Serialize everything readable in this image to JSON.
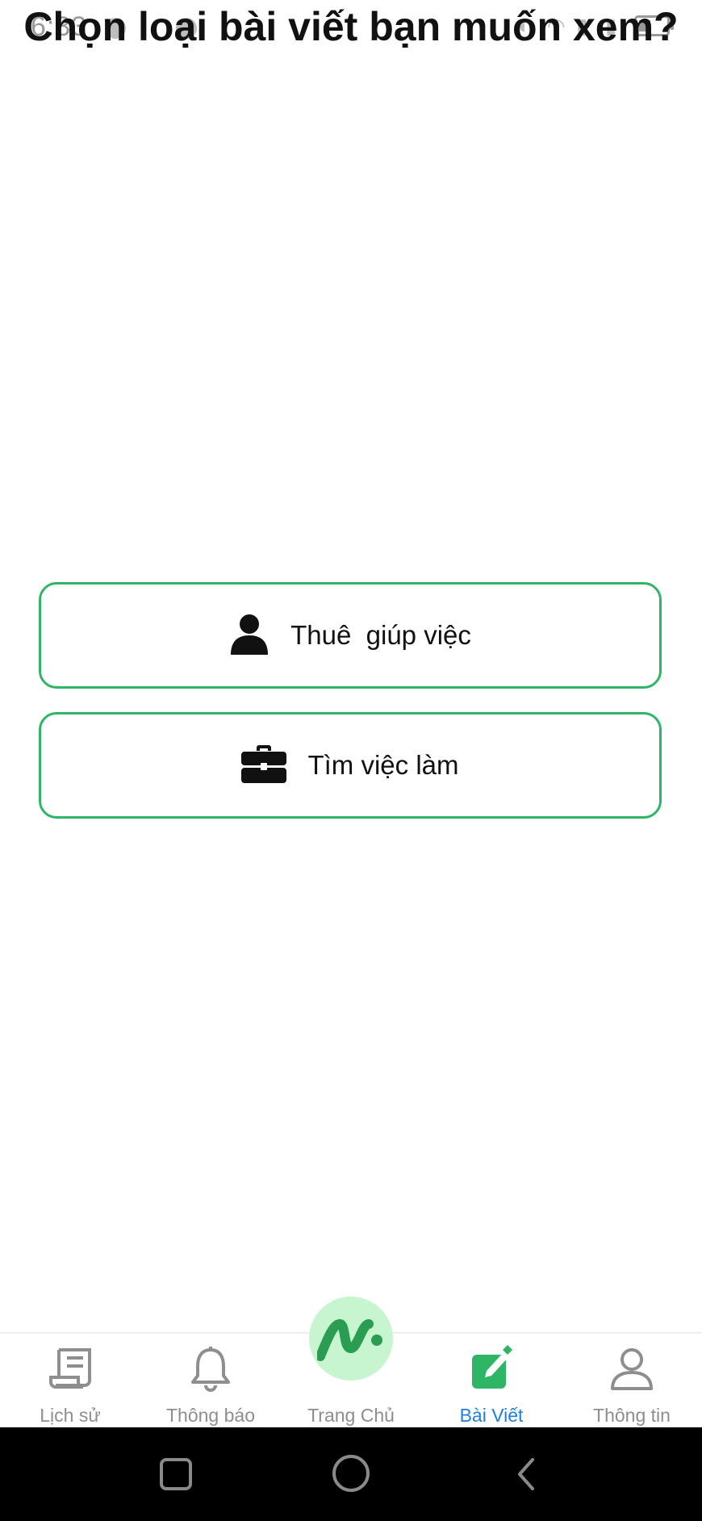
{
  "status_bar": {
    "time": "6:33"
  },
  "header": {
    "title": "Chọn loại bài viết bạn muốn xem?"
  },
  "options": [
    {
      "label": "Thuê  giúp việc",
      "icon": "person-icon"
    },
    {
      "label": "Tìm việc làm",
      "icon": "briefcase-icon"
    }
  ],
  "bottom_nav": {
    "active": "Bài Viết",
    "items": [
      {
        "label": "Lịch sử",
        "icon": "receipt-icon"
      },
      {
        "label": "Thông báo",
        "icon": "bell-icon"
      },
      {
        "label": "Trang Chủ",
        "icon": "home-logo-icon"
      },
      {
        "label": "Bài Viết",
        "icon": "edit-post-icon"
      },
      {
        "label": "Thông tin",
        "icon": "user-outline-icon"
      }
    ]
  },
  "colors": {
    "accent_green": "#2fb566",
    "active_blue": "#1f7fe0",
    "inactive_gray": "#8e8e8e",
    "fab_bg": "#c6f5cf"
  }
}
